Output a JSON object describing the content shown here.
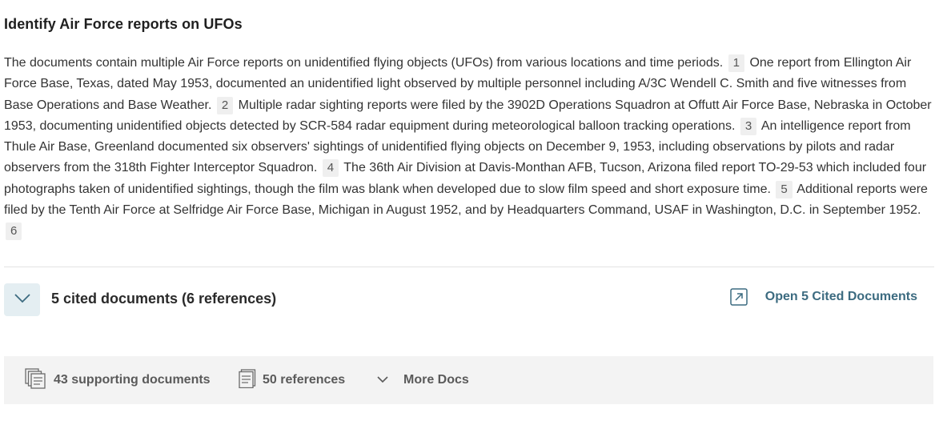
{
  "title": "Identify Air Force reports on UFOs",
  "answer": {
    "segments": [
      "The documents contain multiple Air Force reports on unidentified flying objects (UFOs) from various locations and time periods.",
      "One report from Ellington Air Force Base, Texas, dated May 1953, documented an unidentified light observed by multiple personnel including A/3C Wendell C. Smith and five witnesses from Base Operations and Base Weather.",
      "Multiple radar sighting reports were filed by the 3902D Operations Squadron at Offutt Air Force Base, Nebraska in October 1953, documenting unidentified objects detected by SCR-584 radar equipment during meteorological balloon tracking operations.",
      "An intelligence report from Thule Air Base, Greenland documented six observers' sightings of unidentified flying objects on December 9, 1953, including observations by pilots and radar observers from the 318th Fighter Interceptor Squadron.",
      "The 36th Air Division at Davis-Monthan AFB, Tucson, Arizona filed report TO-29-53 which included four photographs taken of unidentified sightings, though the film was blank when developed due to slow film speed and short exposure time.",
      "Additional reports were filed by the Tenth Air Force at Selfridge Air Force Base, Michigan in August 1952, and by Headquarters Command, USAF in Washington, D.C. in September 1952."
    ],
    "citations": [
      "1",
      "2",
      "3",
      "4",
      "5",
      "6"
    ]
  },
  "cited": {
    "summary": "5 cited documents (6 references)",
    "open_label": "Open 5 Cited Documents",
    "toggle_icon": "chevron-down-icon",
    "open_icon": "external-link-icon"
  },
  "support": {
    "documents": "43 supporting documents",
    "references": "50 references",
    "more": "More Docs",
    "documents_icon": "stacked-documents-icon",
    "references_icon": "document-icon",
    "more_icon": "chevron-down-icon"
  },
  "colors": {
    "accent": "#3c6b80",
    "toggle_bg": "#e4eef2",
    "citation_bg": "#efefef",
    "bar_bg": "#f3f3f3"
  }
}
